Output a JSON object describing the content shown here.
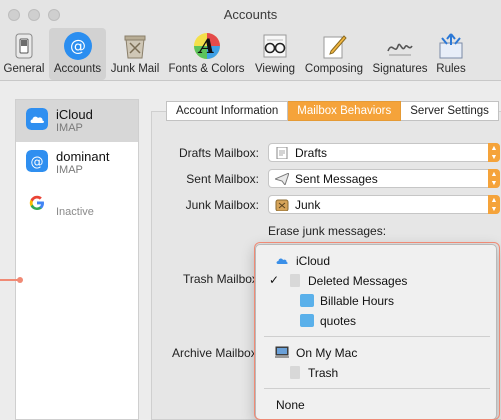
{
  "window": {
    "title": "Accounts"
  },
  "toolbar": {
    "items": [
      {
        "label": "General",
        "icon": "switch-icon"
      },
      {
        "label": "Accounts",
        "icon": "at-icon",
        "selected": true
      },
      {
        "label": "Junk Mail",
        "icon": "junk-icon"
      },
      {
        "label": "Fonts & Colors",
        "icon": "font-icon"
      },
      {
        "label": "Viewing",
        "icon": "glasses-icon"
      },
      {
        "label": "Composing",
        "icon": "pencil-icon"
      },
      {
        "label": "Signatures",
        "icon": "signature-icon"
      },
      {
        "label": "Rules",
        "icon": "rules-icon"
      }
    ]
  },
  "accounts": [
    {
      "name": "iCloud",
      "type": "IMAP",
      "icon": "icloud-icon",
      "selected": true
    },
    {
      "name": "dominant",
      "type": "IMAP",
      "icon": "at-icon"
    },
    {
      "name": "",
      "type": "Inactive",
      "icon": "google-icon"
    }
  ],
  "tabs": [
    {
      "label": "Account Information"
    },
    {
      "label": "Mailbox Behaviors",
      "active": true
    },
    {
      "label": "Server Settings"
    }
  ],
  "form": {
    "drafts_label": "Drafts Mailbox:",
    "drafts_value": "Drafts",
    "sent_label": "Sent Mailbox:",
    "sent_value": "Sent Messages",
    "junk_label": "Junk Mailbox:",
    "junk_value": "Junk",
    "erase_label": "Erase junk messages:",
    "trash_label": "Trash Mailbox",
    "archive_label": "Archive Mailbox"
  },
  "menu": {
    "items": [
      {
        "label": "iCloud",
        "kind": "account",
        "icon": "icloud-icon"
      },
      {
        "label": "Deleted Messages",
        "kind": "mailbox",
        "icon": "trash-icon",
        "checked": true
      },
      {
        "label": "Billable Hours",
        "kind": "folder",
        "icon": "folder-icon"
      },
      {
        "label": "quotes",
        "kind": "folder",
        "icon": "folder-icon"
      },
      {
        "label": "On My Mac",
        "kind": "account",
        "icon": "computer-icon"
      },
      {
        "label": "Trash",
        "kind": "mailbox",
        "icon": "trash-icon"
      },
      {
        "label": "None",
        "kind": "option"
      }
    ]
  },
  "colors": {
    "accent": "#f5a33a",
    "highlight": "#f08a75",
    "folder": "#5ab0ea"
  }
}
